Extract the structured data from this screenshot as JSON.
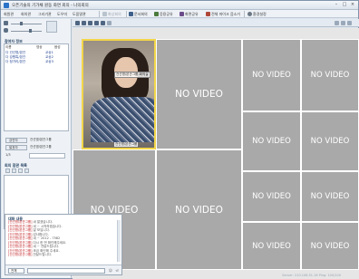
{
  "window": {
    "title": "오픈기술의 기가채 원동 화면 회의 - 나의회의"
  },
  "menu": [
    "회원관",
    "회의관",
    "그리기관",
    "도우미",
    "도움말관"
  ],
  "toolbar": {
    "buttons": [
      {
        "label": "화상회의",
        "icon": "monitor-icon",
        "disabled": true
      },
      {
        "label": "문서회의",
        "icon": "document-icon",
        "disabled": false
      },
      {
        "label": "응용공유",
        "icon": "share-icon",
        "disabled": false
      },
      {
        "label": "화면공유",
        "icon": "screen-share-icon",
        "disabled": false
      },
      {
        "label": "전체 마이크 음소거",
        "icon": "mic-mute-icon",
        "disabled": false
      },
      {
        "label": "환경설정",
        "icon": "gear-icon",
        "disabled": false
      }
    ]
  },
  "participants": {
    "title": "참여자 정보",
    "columns": [
      "이름",
      "영상",
      "음성"
    ],
    "rows": [
      {
        "name": "다 건선명/본관",
        "cam": "교상1"
      },
      {
        "name": "다 강원특/본관",
        "cam": "교상2"
      },
      {
        "name": "다 정가리/본관",
        "cam": "교상3"
      }
    ],
    "speaker_label": "강연자",
    "speaker_value": "건선명/본관그룹",
    "host_label": "발표자",
    "host_value": "건선명/본관그룹",
    "count": "1/3"
  },
  "conference_list": {
    "title": "회의 참관 목록"
  },
  "chat": {
    "title": "대화 내용",
    "messages": [
      {
        "sender": "[건선명/본관그룹]",
        "text": "네 알겠습니다."
      },
      {
        "sender": "[건선명/본관그룹]",
        "text": "네 ~ 시작하겠습니다."
      },
      {
        "sender": "[건선명/본관그룹]",
        "text": "잘 보입니다."
      },
      {
        "sender": "[건선명/본관그룹]",
        "text": "감사합니다."
      },
      {
        "sender": "[건선명/본관그룹]",
        "text": "네 ~ 2012 - 7582"
      },
      {
        "sender": "[건선명/본관그룹]",
        "text": "다시 한 번 확인해주세요."
      },
      {
        "sender": "[건선명/본관그룹]",
        "text": "네 ~ 전달드립니다."
      },
      {
        "sender": "[건선명/본관그룹]",
        "text": "조금 확인해 주세요."
      },
      {
        "sender": "[건선명/본관그룹]",
        "text": "전달드립니다."
      }
    ],
    "recipient": "전체",
    "input_value": ""
  },
  "video": {
    "active_label": "건선명/본관그룹-회의실",
    "active_name": "건선명/본관그룹",
    "tiles": [
      "NO VIDEO",
      "NO VIDEO",
      "NO VIDEO",
      "NO VIDEO",
      "NO VIDEO",
      "NO VIDEO",
      "NO VIDEO",
      "NO VIDEO",
      "NO VIDEO",
      "NO VIDEO",
      "NO VIDEO"
    ]
  },
  "status": {
    "text": "Server: 210.108.51.16  Ping: 100/100"
  },
  "colors": {
    "accent": "#2b72c9",
    "chat_sender": "#c0181d",
    "tile_bg": "#a9a9a9",
    "active_border": "#f2d64a"
  }
}
